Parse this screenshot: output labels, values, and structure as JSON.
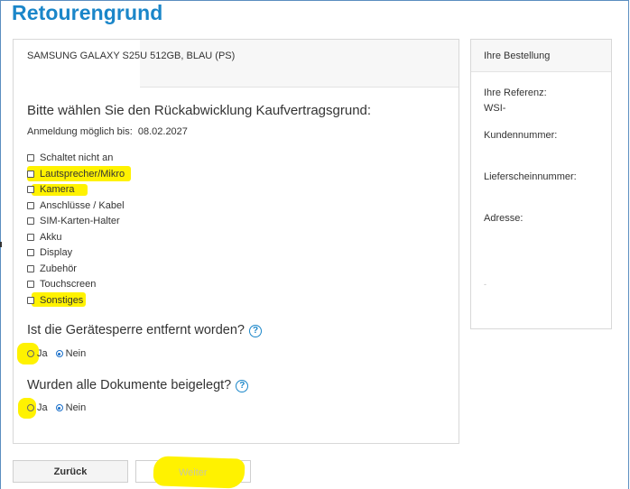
{
  "page": {
    "title": "Retourengrund"
  },
  "product": {
    "name": "SAMSUNG GALAXY S25U 512GB, BLAU (PS)"
  },
  "form": {
    "question": "Bitte wählen Sie den Rückabwicklung Kaufvertragsgrund:",
    "deadline_label": "Anmeldung möglich bis:",
    "deadline_date": "08.02.2027",
    "reasons": [
      {
        "label": "Schaltet nicht an",
        "checked": false
      },
      {
        "label": "Lautsprecher/Mikro",
        "checked": false
      },
      {
        "label": "Kamera",
        "checked": false
      },
      {
        "label": "Anschlüsse / Kabel",
        "checked": false
      },
      {
        "label": "SIM-Karten-Halter",
        "checked": false
      },
      {
        "label": "Akku",
        "checked": false
      },
      {
        "label": "Display",
        "checked": false
      },
      {
        "label": "Zubehör",
        "checked": false
      },
      {
        "label": "Touchscreen",
        "checked": false
      },
      {
        "label": "Sonstiges",
        "checked": false
      }
    ],
    "device_lock": {
      "question": "Ist die Gerätesperre entfernt worden?",
      "yes_label": "Ja",
      "no_label": "Nein",
      "selected": "Nein"
    },
    "documents": {
      "question": "Wurden alle Dokumente beigelegt?",
      "yes_label": "Ja",
      "no_label": "Nein",
      "selected": "Nein"
    },
    "help_icon": "help-circle-icon"
  },
  "sidebar": {
    "title": "Ihre Bestellung",
    "reference_label": "Ihre Referenz:",
    "reference_value": "WSI-",
    "customer_number_label": "Kundennummer:",
    "delivery_note_label": "Lieferscheinnummer:",
    "address_label": "Adresse:",
    "placeholder_dash": "-"
  },
  "buttons": {
    "back": "Zurück",
    "next": "Weiter"
  },
  "colors": {
    "title": "#1a86c9",
    "highlight": "#fff200",
    "radio_selected": "#1a6fc9"
  }
}
